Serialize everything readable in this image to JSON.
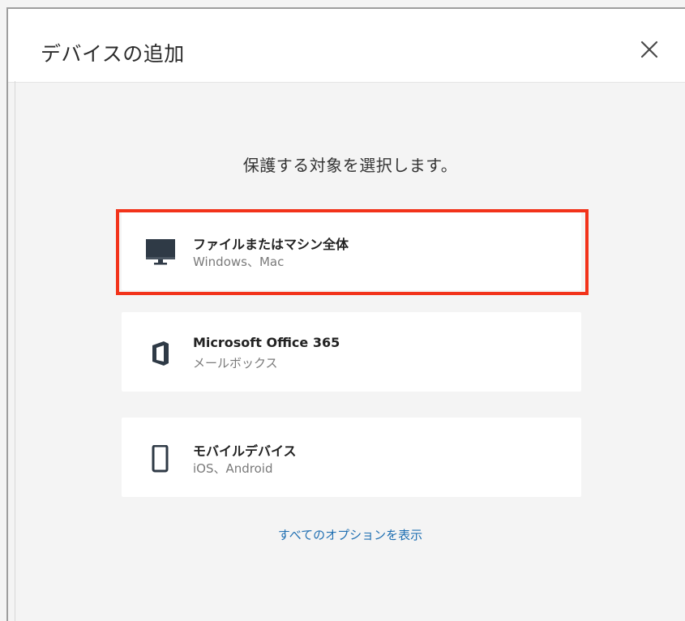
{
  "dialog": {
    "title": "デバイスの追加",
    "close_icon": "close-icon"
  },
  "body": {
    "prompt": "保護する対象を選択します。",
    "options": [
      {
        "icon": "monitor-icon",
        "label": "ファイルまたはマシン全体",
        "sub": "Windows、Mac",
        "selected": true
      },
      {
        "icon": "office-icon",
        "label": "Microsoft Office 365",
        "sub": "メールボックス",
        "selected": false
      },
      {
        "icon": "mobile-phone-icon",
        "label": "モバイルデバイス",
        "sub": "iOS、Android",
        "selected": false
      }
    ],
    "show_all_link": "すべてのオプションを表示"
  },
  "colors": {
    "highlight": "#f2331a",
    "link": "#1f6fb2",
    "background": "#f4f4f4",
    "card": "#ffffff"
  }
}
